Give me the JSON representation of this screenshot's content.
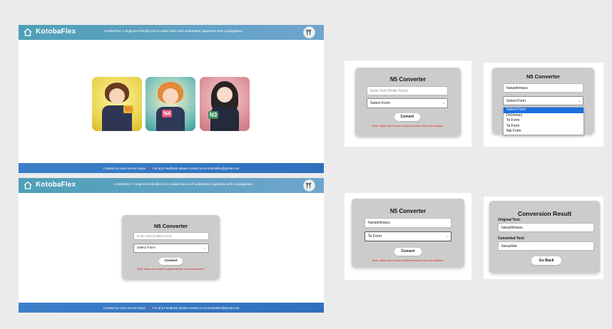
{
  "app": {
    "brand": "KotobaFlex",
    "tagline": "KotobaFlex: A beginner-friendly tool to easily learn and understand Japanese verb conjugations.",
    "footer_credit": "Created by some secret ninjas",
    "footer_heart": "❤",
    "footer_contact": "For any Feedback please contact us at kotobaflex@gmail.com"
  },
  "levels": [
    {
      "label": "N5",
      "color": "#e3c63a"
    },
    {
      "label": "N4",
      "color": "#4aa9a6"
    },
    {
      "label": "N3",
      "color": "#d98892"
    }
  ],
  "converter": {
    "title": "N5 Converter",
    "input_placeholder": "Enter Text (Polite Form)",
    "select_default": "Select Form",
    "convert_label": "Convert",
    "note": "*Note: Make sure to leave a space between verb and shimasu.*",
    "typed_value": "hanashimasu",
    "selected_form": "Te Form",
    "form_options": [
      "Select Form",
      "Dictionary",
      "Te Form",
      "Ta Form",
      "Nai Form"
    ]
  },
  "result": {
    "title": "Conversion Result",
    "original_label": "Original Text:",
    "original_value": "hanashimasu",
    "converted_label": "Converted Text:",
    "converted_value": "hanashite",
    "back_label": "Go Back"
  },
  "icons": {
    "home": "home-icon",
    "torii": "torii-gate-icon",
    "chevron": "chevron-down-icon"
  },
  "colors": {
    "header": "#5fa3c3",
    "footer": "#3577c4",
    "note": "#e01b1b",
    "dropdown_highlight": "#1a6fe0"
  }
}
